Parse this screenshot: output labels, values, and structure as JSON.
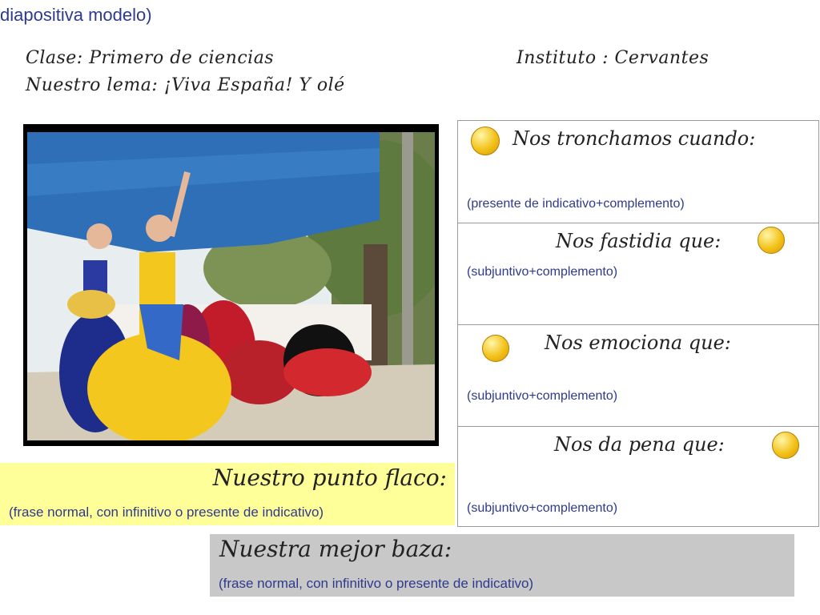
{
  "header": {
    "title": "diapositiva modelo)"
  },
  "info": {
    "clase": "Clase: Primero de ciencias",
    "lema": "Nuestro lema: ¡Viva España! Y olé",
    "instituto": "Instituto : Cervantes"
  },
  "table": {
    "rows": [
      {
        "title": "Nos tronchamos cuando:",
        "subtitle": "(presente de indicativo+complemento)",
        "icon": "laughing-face-icon"
      },
      {
        "title": "Nos fastidia que:",
        "subtitle": "(subjuntivo+complemento)",
        "icon": "angry-face-icon"
      },
      {
        "title": "Nos emociona que:",
        "subtitle": "(subjuntivo+complemento)",
        "icon": "love-face-icon"
      },
      {
        "title": "Nos da pena que:",
        "subtitle": "(subjuntivo+complemento)",
        "icon": "sad-face-icon"
      }
    ]
  },
  "punto_flaco": {
    "title": "Nuestro punto flaco:",
    "subtitle": "(frase normal, con infinitivo o presente de indicativo)"
  },
  "mejor_baza": {
    "title": "Nuestra mejor baza:",
    "subtitle": "(frase normal, con infinitivo o presente de indicativo)"
  },
  "colors": {
    "subtitle_blue": "#2e3a8c",
    "yellow_box": "#ffff99",
    "gray_box": "#c8c8c8"
  }
}
